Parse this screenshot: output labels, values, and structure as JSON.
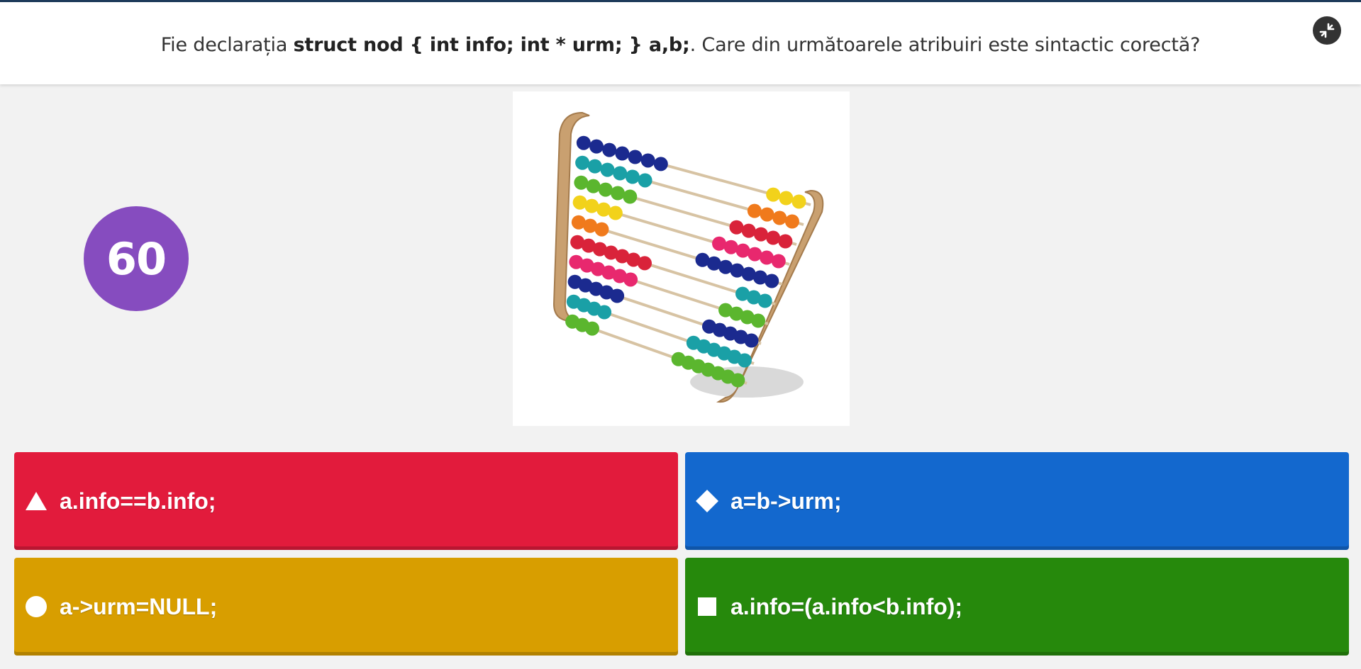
{
  "question": {
    "prefix": "Fie declarația ",
    "code": "struct nod { int info; int * urm; } a,b;",
    "suffix": ". Care din următoarele atribuiri este sintactic corectă?"
  },
  "timer": {
    "value": "60"
  },
  "fullscreen": {
    "icon": "fullscreen-exit-icon"
  },
  "image": {
    "subject": "abacus"
  },
  "answers": [
    {
      "label": "a.info==b.info;",
      "shape": "triangle-icon",
      "color": "#e21b3c"
    },
    {
      "label": "a=b->urm;",
      "shape": "diamond-icon",
      "color": "#1368ce"
    },
    {
      "label": "a->urm=NULL;",
      "shape": "circle-icon",
      "color": "#d89e00"
    },
    {
      "label": "a.info=(a.info<b.info);",
      "shape": "square-icon",
      "color": "#26890c"
    }
  ],
  "colors": {
    "timer": "#864cbf",
    "background": "#f2f2f2",
    "header": "#ffffff"
  }
}
